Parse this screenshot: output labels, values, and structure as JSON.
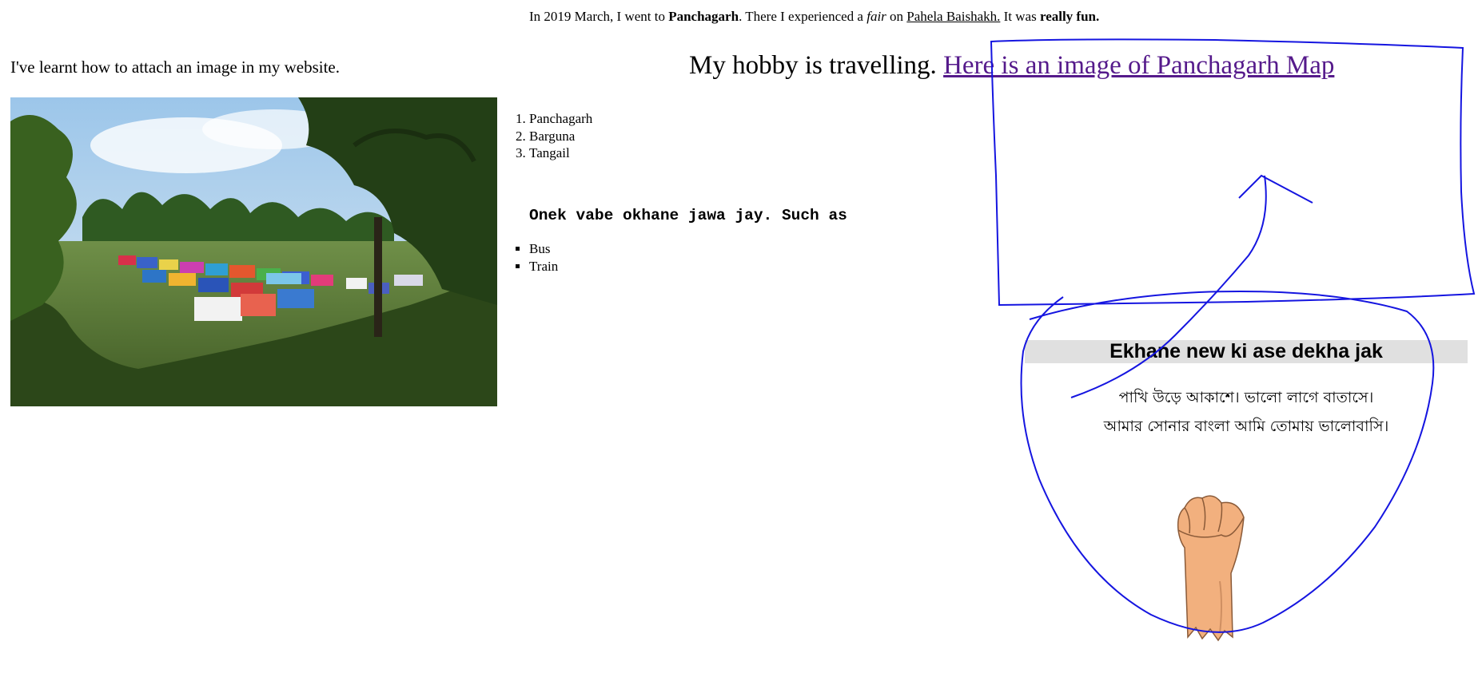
{
  "intro": {
    "part1": "In 2019 March, I went to ",
    "place": "Panchagarh",
    "part2": ". There I experienced a ",
    "fair": "fair",
    "part3": " on ",
    "festival": "Pahela Baishakh.",
    "part4": " It was ",
    "emphasis": "really fun."
  },
  "learnt_text": "I've learnt how to attach an image in my website.",
  "hobby": {
    "text": "My hobby is travelling. ",
    "link": "Here is an image of Panchagarh Map"
  },
  "places": [
    "Panchagarh",
    "Barguna",
    "Tangail"
  ],
  "reach_heading": "Onek vabe okhane jawa jay. Such as",
  "transport": [
    "Bus",
    "Train"
  ],
  "new_section": {
    "heading": "Ekhane new ki ase dekha jak",
    "lines": [
      "পাখি উড়ে আকাশে। ভালো লাগে বাতাসে।",
      "আমার সোনার বাংলা আমি তোমায় ভালোবাসি।"
    ]
  },
  "colors": {
    "link": "#551a8b",
    "scribble": "#1515e0",
    "heading_bar": "#e0e0e0",
    "skin": "#f2b07e"
  },
  "icons": {
    "photo": "fair-tents-field-photo",
    "fist": "raised-fist-illustration"
  }
}
